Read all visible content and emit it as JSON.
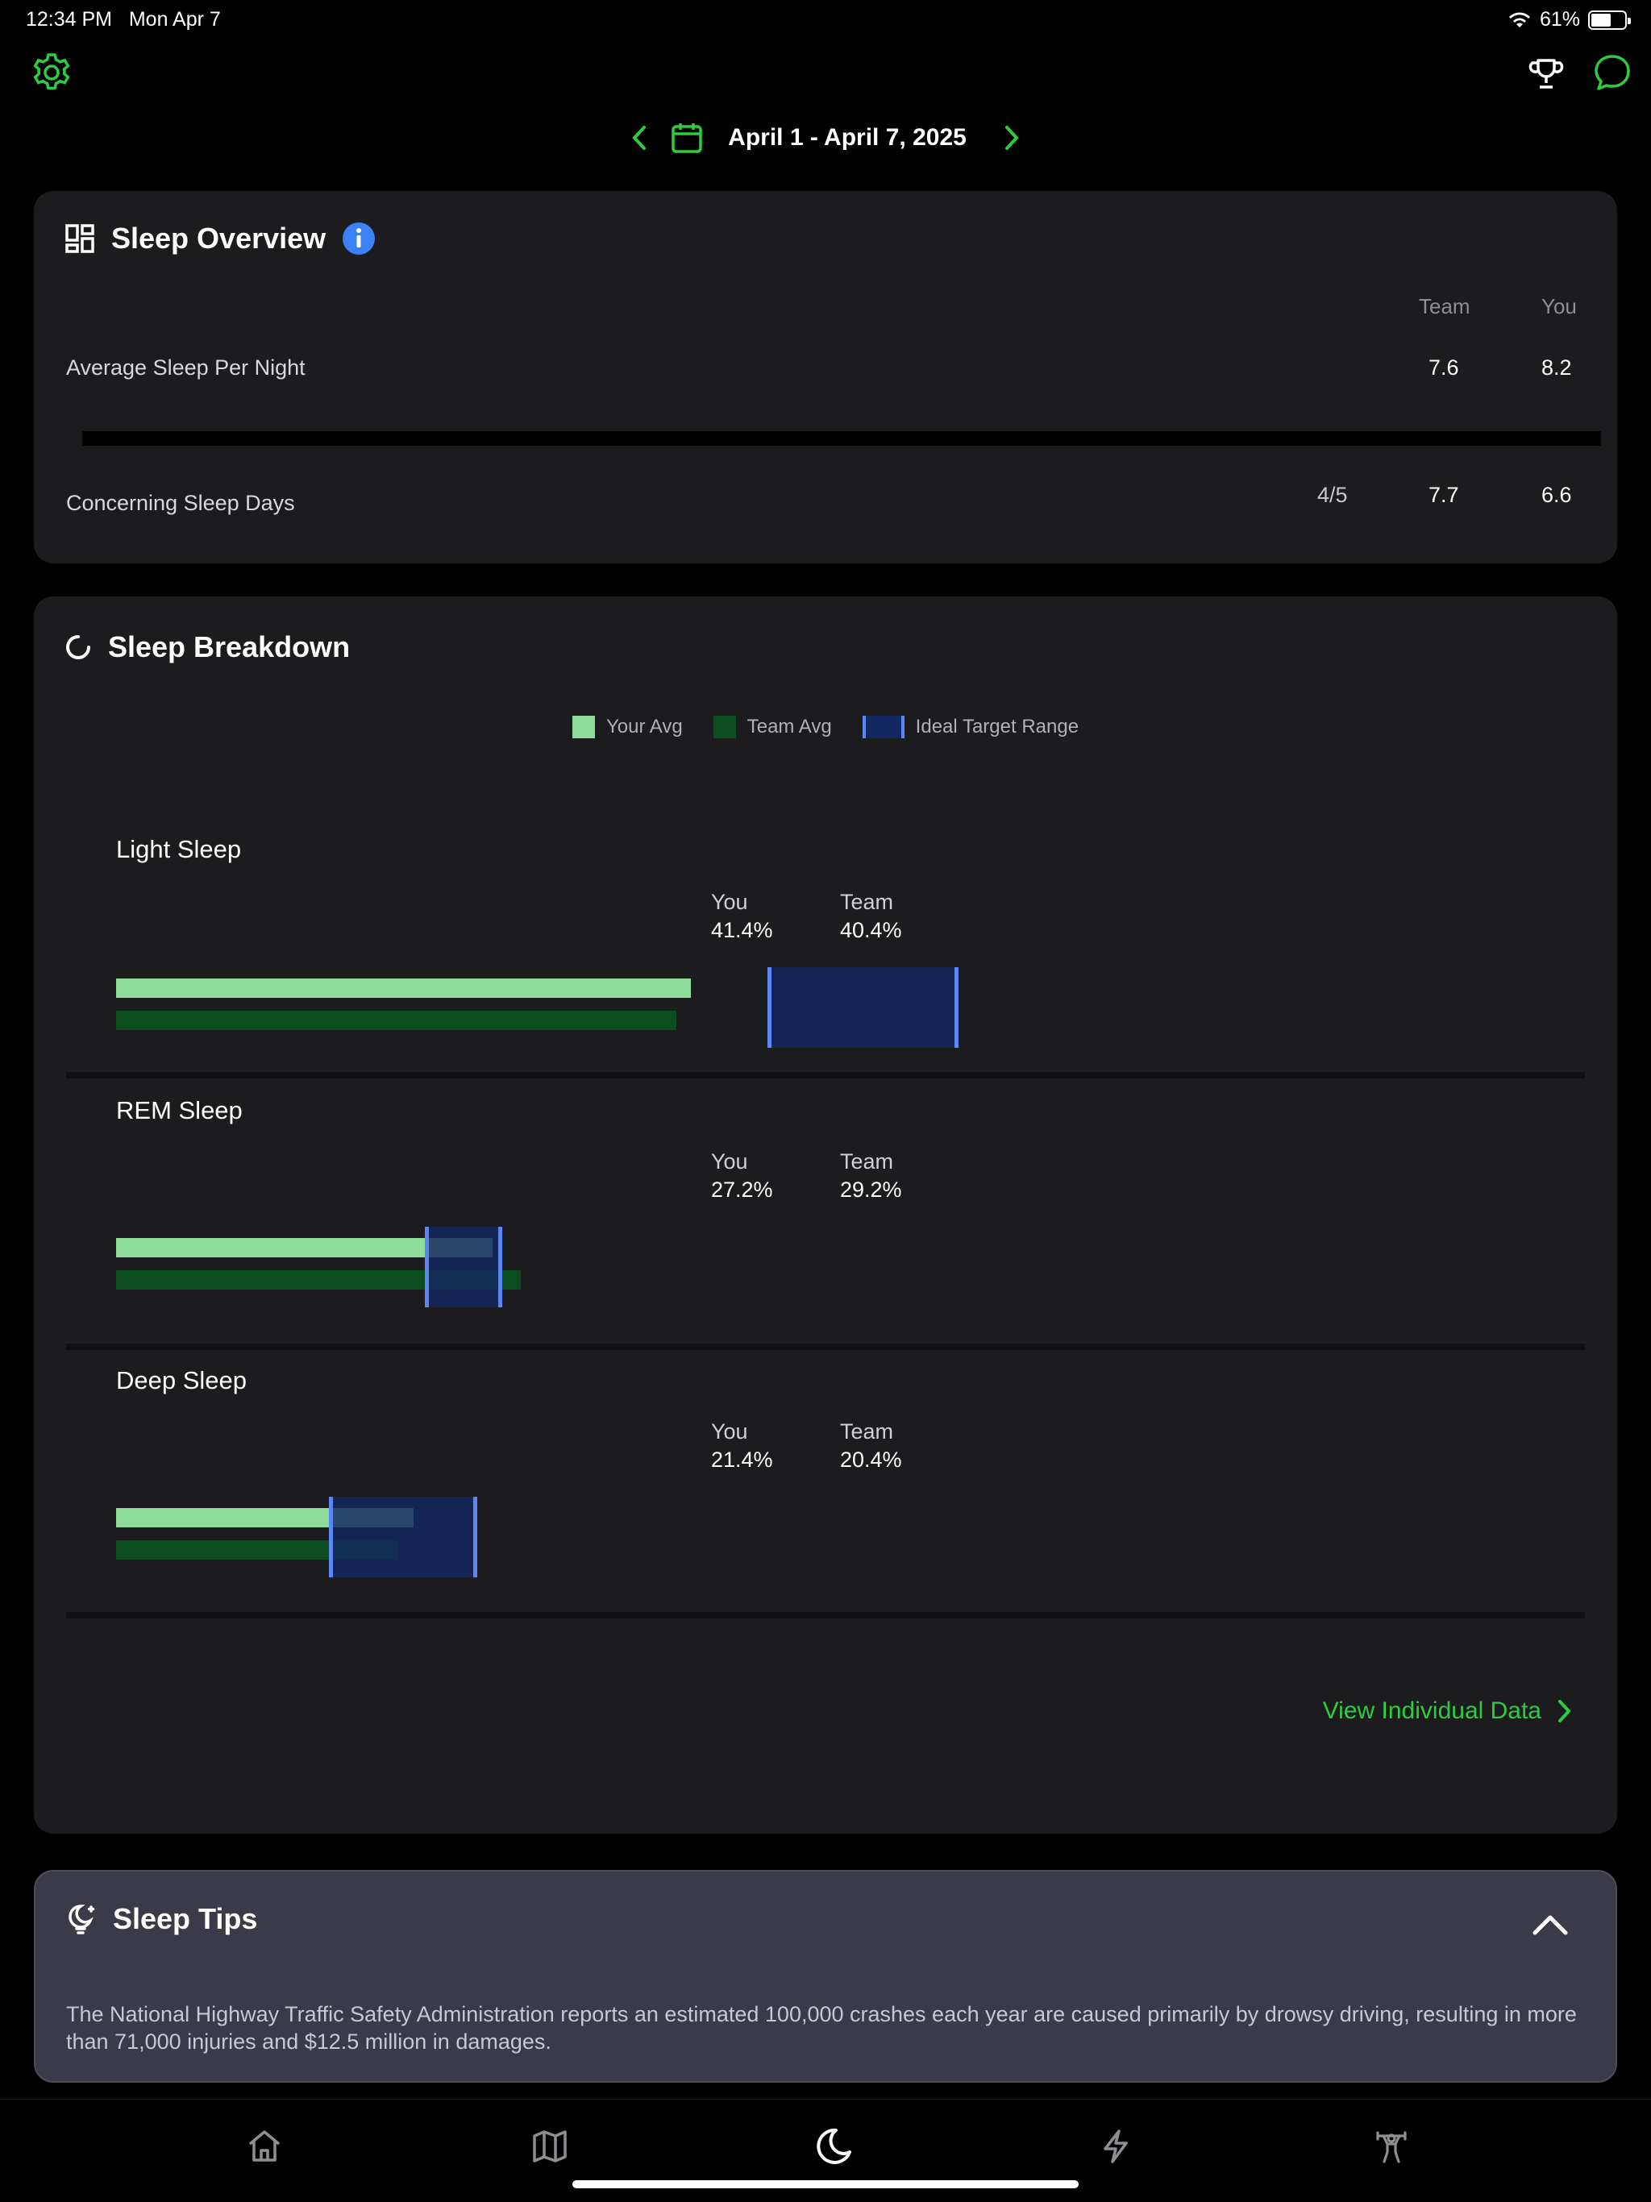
{
  "status_bar": {
    "time": "12:34 PM",
    "date": "Mon Apr 7",
    "battery": "61%",
    "battery_level": 0.61
  },
  "header": {
    "date_range": "April 1 - April 7, 2025"
  },
  "colors": {
    "accent_green": "#2ecc40",
    "your_avg": "#8fdc9a",
    "team_avg": "#0b4d1e",
    "target_fill": "#12275f",
    "target_edge": "#5b86f5"
  },
  "overview": {
    "title": "Sleep Overview",
    "col_team": "Team",
    "col_you": "You",
    "rows": [
      {
        "label": "Average Sleep Per Night",
        "fraction": "",
        "team": "7.6",
        "you": "8.2"
      },
      {
        "label": "Concerning Sleep Days",
        "fraction": "4/5",
        "team": "7.7",
        "you": "6.6"
      }
    ]
  },
  "breakdown": {
    "title": "Sleep Breakdown",
    "legend": {
      "you": "Your Avg",
      "team": "Team Avg",
      "target": "Ideal Target Range"
    },
    "you_label": "You",
    "team_label": "Team",
    "stages": [
      {
        "name": "Light Sleep",
        "you": "41.4%",
        "team": "40.4%"
      },
      {
        "name": "REM Sleep",
        "you": "27.2%",
        "team": "29.2%"
      },
      {
        "name": "Deep Sleep",
        "you": "21.4%",
        "team": "20.4%"
      }
    ],
    "view_link": "View Individual Data"
  },
  "tips": {
    "title": "Sleep Tips",
    "text": "The National Highway Traffic Safety Administration reports an estimated 100,000 crashes each year are caused primarily by drowsy driving, resulting in more than 71,000 injuries and $12.5 million in damages."
  },
  "tabs": [
    {
      "icon": "home-icon"
    },
    {
      "icon": "map-icon"
    },
    {
      "icon": "moon-icon",
      "active": true
    },
    {
      "icon": "lightning-icon"
    },
    {
      "icon": "weightlifter-icon"
    }
  ]
}
